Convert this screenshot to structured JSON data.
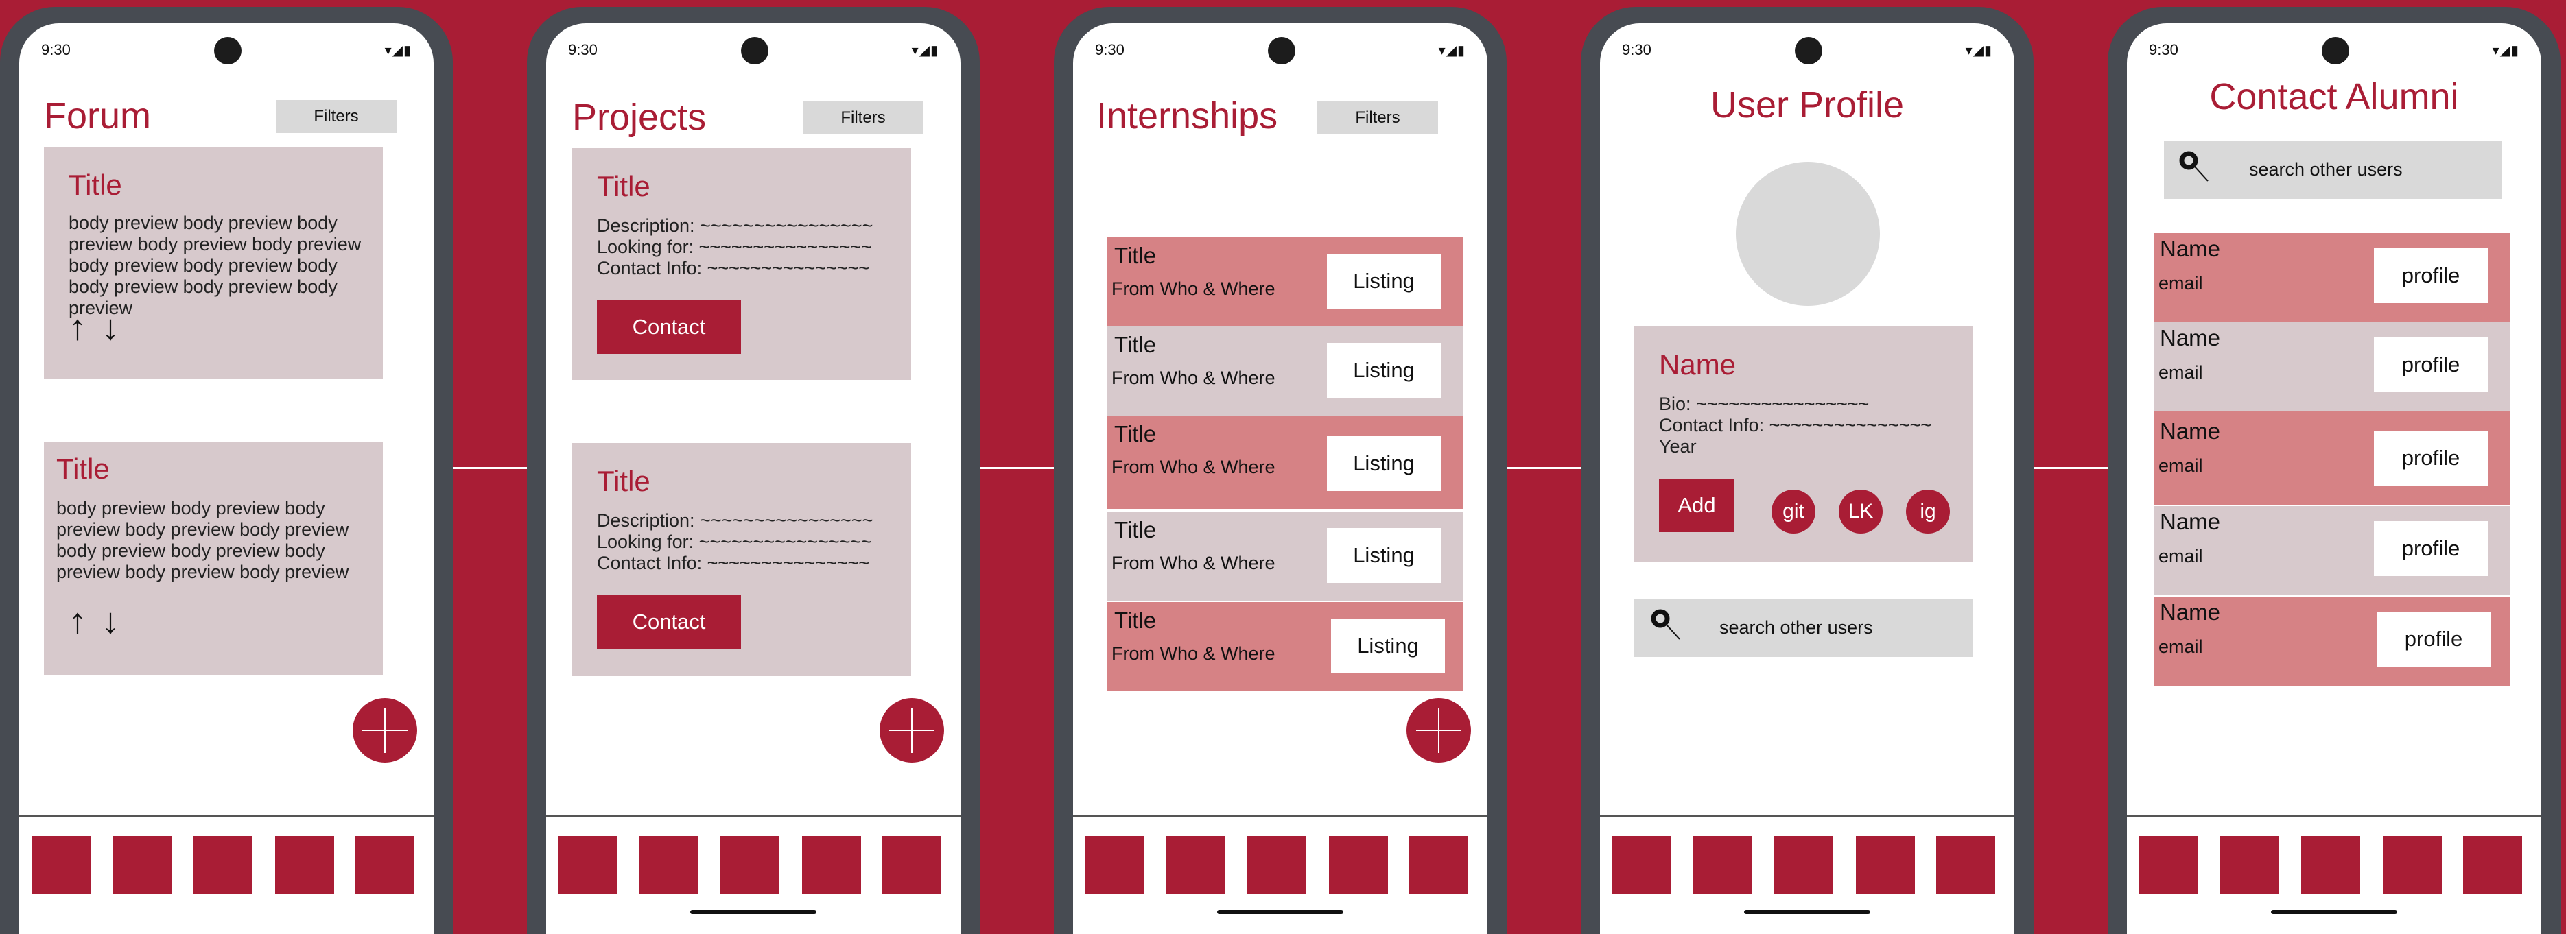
{
  "status": {
    "time": "9:30",
    "icons": "▾◢▮"
  },
  "forum": {
    "title": "Forum",
    "filters": "Filters",
    "posts": [
      {
        "title": "Title",
        "body": "body preview body preview body preview body preview body preview body preview body preview body body preview body preview body preview",
        "up": "↑",
        "down": "↓"
      },
      {
        "title": "Title",
        "body": "body preview body preview body preview body preview body preview body preview body preview body preview body preview body preview",
        "up": "↑",
        "down": "↓"
      }
    ]
  },
  "projects": {
    "title": "Projects",
    "filters": "Filters",
    "items": [
      {
        "title": "Title",
        "description": "Description: ~~~~~~~~~~~~~~~~",
        "looking": "Looking for: ~~~~~~~~~~~~~~~~",
        "contact_info": "Contact Info: ~~~~~~~~~~~~~~~",
        "button": "Contact"
      },
      {
        "title": "Title",
        "description": "Description: ~~~~~~~~~~~~~~~~",
        "looking": "Looking for: ~~~~~~~~~~~~~~~~",
        "contact_info": "Contact Info: ~~~~~~~~~~~~~~~",
        "button": "Contact"
      }
    ]
  },
  "internships": {
    "title": "Internships",
    "filters": "Filters",
    "items": [
      {
        "title": "Title",
        "subtitle": "From Who & Where",
        "button": "Listing"
      },
      {
        "title": "Title",
        "subtitle": "From Who & Where",
        "button": "Listing"
      },
      {
        "title": "Title",
        "subtitle": "From Who & Where",
        "button": "Listing"
      },
      {
        "title": "Title",
        "subtitle": "From Who & Where",
        "button": "Listing"
      },
      {
        "title": "Title",
        "subtitle": "From Who & Where",
        "button": "Listing"
      }
    ]
  },
  "profile": {
    "title": "User Profile",
    "name": "Name",
    "bio": "Bio: ~~~~~~~~~~~~~~~~",
    "contact_info": "Contact Info: ~~~~~~~~~~~~~~~",
    "year": "Year",
    "add": "Add",
    "links": [
      "git",
      "LK",
      "ig"
    ],
    "search_placeholder": "search other users"
  },
  "alumni": {
    "title": "Contact Alumni",
    "search_placeholder": "search other users",
    "items": [
      {
        "name": "Name",
        "email": "email",
        "button": "profile"
      },
      {
        "name": "Name",
        "email": "email",
        "button": "profile"
      },
      {
        "name": "Name",
        "email": "email",
        "button": "profile"
      },
      {
        "name": "Name",
        "email": "email",
        "button": "profile"
      },
      {
        "name": "Name",
        "email": "email",
        "button": "profile"
      }
    ]
  },
  "colors": {
    "brand": "#a91d35",
    "card": "#d7c9cc",
    "row_pink": "#d68285",
    "neutral": "#d9d9d9"
  }
}
